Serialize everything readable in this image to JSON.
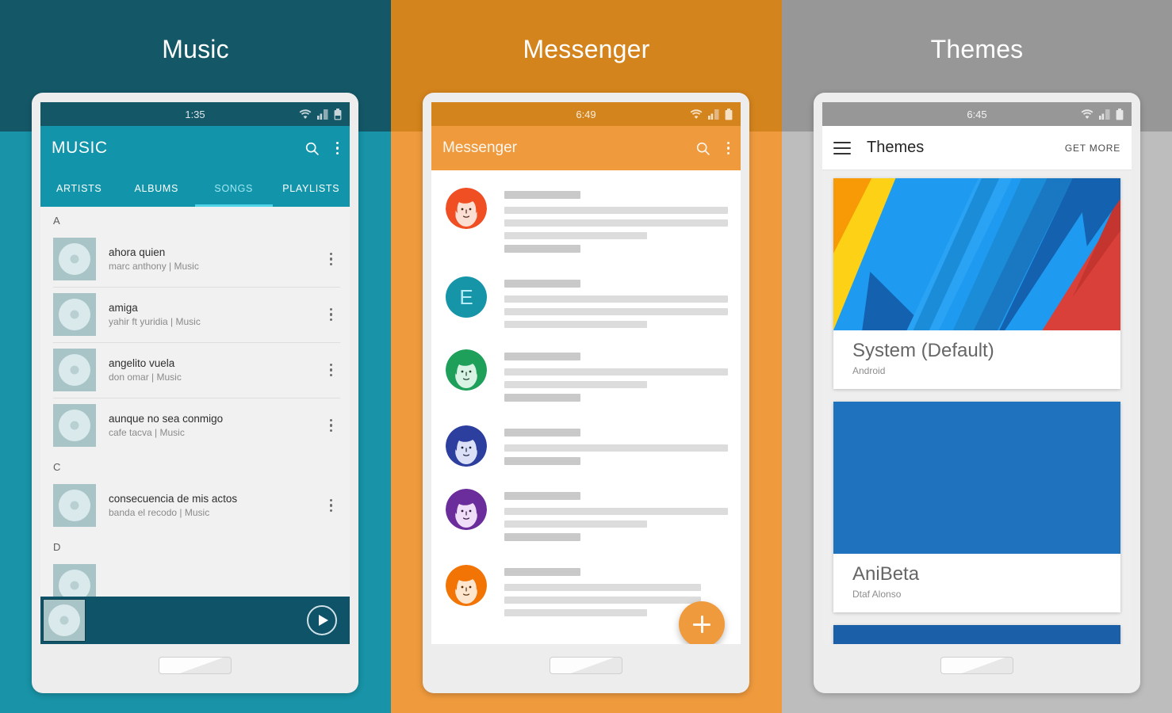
{
  "panels": [
    {
      "key": "music",
      "title": "Music",
      "bg_top": "#145868",
      "bg_bottom": "#1893a7",
      "status": {
        "time": "1:35",
        "wifi_icon": "wifi-icon",
        "signal_icon": "signal-icon",
        "battery_icon": "battery-icon"
      },
      "appbar": {
        "title": "MUSIC",
        "search_icon": "search-icon",
        "overflow_icon": "overflow-menu-icon"
      },
      "tabs": [
        {
          "label": "ARTISTS",
          "active": false
        },
        {
          "label": "ALBUMS",
          "active": false
        },
        {
          "label": "SONGS",
          "active": true
        },
        {
          "label": "PLAYLISTS",
          "active": false
        }
      ],
      "sections": [
        {
          "letter": "A",
          "songs": [
            {
              "title": "ahora quien",
              "subtitle": "marc anthony | Music"
            },
            {
              "title": "amiga",
              "subtitle": "yahir ft yuridia | Music"
            },
            {
              "title": "angelito vuela",
              "subtitle": "don omar | Music"
            },
            {
              "title": "aunque no sea conmigo",
              "subtitle": "cafe tacva | Music"
            }
          ]
        },
        {
          "letter": "C",
          "songs": [
            {
              "title": "consecuencia de mis actos",
              "subtitle": "banda el recodo | Music"
            }
          ]
        },
        {
          "letter": "D",
          "songs": [
            {
              "title": "",
              "subtitle": ""
            }
          ]
        }
      ],
      "nowplaying": {
        "play_icon": "play-icon",
        "bar_color": "#0f5369"
      }
    },
    {
      "key": "messenger",
      "title": "Messenger",
      "bg_top": "#d4841c",
      "bg_bottom": "#ef9a3d",
      "status": {
        "time": "6:49",
        "wifi_icon": "wifi-icon",
        "signal_icon": "signal-icon",
        "battery_icon": "battery-icon"
      },
      "appbar": {
        "title": "Messenger",
        "search_icon": "search-icon",
        "overflow_icon": "overflow-menu-icon"
      },
      "conversations": [
        {
          "avatar_color": "#f04e23",
          "avatar_type": "face",
          "lines": [
            34,
            100,
            100,
            64,
            34
          ]
        },
        {
          "avatar_color": "#1695a8",
          "avatar_type": "letter",
          "letter": "E",
          "lines": [
            34,
            100,
            100,
            64
          ]
        },
        {
          "avatar_color": "#1ea05a",
          "avatar_type": "face",
          "lines": [
            34,
            100,
            64,
            34
          ]
        },
        {
          "avatar_color": "#2c3e9e",
          "avatar_type": "face",
          "lines": [
            34,
            100,
            34
          ]
        },
        {
          "avatar_color": "#6a2d9b",
          "avatar_type": "face",
          "lines": [
            34,
            100,
            64,
            34
          ]
        },
        {
          "avatar_color": "#f27405",
          "avatar_type": "face",
          "lines": [
            34,
            88,
            88,
            64
          ]
        }
      ],
      "fab": {
        "icon": "plus-icon",
        "color": "#ef9a3d"
      }
    },
    {
      "key": "themes",
      "title": "Themes",
      "bg_top": "#979797",
      "bg_bottom": "#bdbdbd",
      "status": {
        "time": "6:45",
        "wifi_icon": "wifi-icon",
        "signal_icon": "signal-icon",
        "battery_icon": "battery-icon"
      },
      "appbar": {
        "menu_icon": "hamburger-menu-icon",
        "title": "Themes",
        "action_label": "GET MORE"
      },
      "theme_cards": [
        {
          "name": "System (Default)",
          "author": "Android",
          "preview": "material-shards",
          "partial": false
        },
        {
          "name": "AniBeta",
          "author": "Dtaf Alonso",
          "preview": "solid-blue",
          "color": "#1f72bd",
          "partial": false
        },
        {
          "name": "",
          "author": "",
          "preview": "solid-blue",
          "color": "#1a5fa8",
          "partial": true
        }
      ]
    }
  ],
  "colors": {
    "music_accent": "#1295ab",
    "music_tab_active": "#9fe7f2",
    "music_underline": "#4fd3e6",
    "messenger_accent": "#ef9a3d",
    "themes_accent": "#ffffff"
  }
}
